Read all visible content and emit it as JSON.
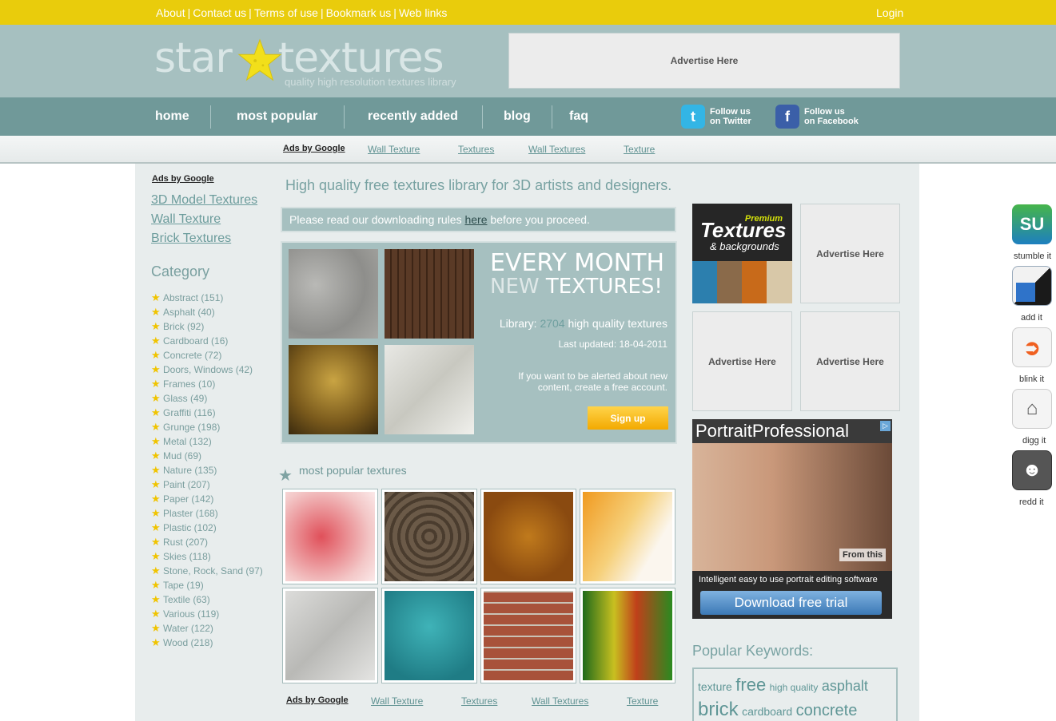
{
  "topbar": {
    "links": [
      "About",
      "Contact us",
      "Terms of use",
      "Bookmark us",
      "Web links"
    ],
    "separator": "|",
    "login": "Login"
  },
  "header": {
    "logo_left": "star",
    "logo_right": "textures",
    "tagline": "quality high resolution textures library",
    "ad": "Advertise Here"
  },
  "nav": {
    "items": [
      "home",
      "most popular",
      "recently added",
      "blog",
      "faq"
    ],
    "twitter": [
      "Follow us",
      "on Twitter"
    ],
    "facebook": [
      "Follow us",
      "on Facebook"
    ]
  },
  "adbar": {
    "ads_by": "Ads by Google",
    "links": [
      "Wall Texture",
      "Textures",
      "Wall Textures",
      "Texture"
    ]
  },
  "sidebar": {
    "ads_by": "Ads by Google",
    "links": [
      "3D Model Textures",
      "Wall Texture",
      "Brick Textures"
    ],
    "category_title": "Category",
    "categories": [
      "Abstract (151)",
      "Asphalt (40)",
      "Brick (92)",
      "Cardboard (16)",
      "Concrete (72)",
      "Doors, Windows (42)",
      "Frames (10)",
      "Glass (49)",
      "Graffiti (116)",
      "Grunge (198)",
      "Metal (132)",
      "Mud (69)",
      "Nature (135)",
      "Paint (207)",
      "Paper (142)",
      "Plaster (168)",
      "Plastic (102)",
      "Rust (207)",
      "Skies (118)",
      "Stone, Rock, Sand (97)",
      "Tape (19)",
      "Textile (63)",
      "Various (119)",
      "Water (122)",
      "Wood (218)"
    ]
  },
  "main": {
    "tagline": "High quality free textures library for 3D artists and designers.",
    "rules_before": "Please read our downloading rules ",
    "rules_link": "here",
    "rules_after": " before you proceed.",
    "promo": {
      "line1": "EVERY MONTH",
      "line2a": "NEW",
      "line2b": " TEXTURES!",
      "library_label": "Library: ",
      "library_count": "2704",
      "library_suffix": " high quality textures",
      "updated": "Last updated: 18-04-2011",
      "alert": "If you want to be alerted about new content, create a free account.",
      "signup": "Sign up"
    },
    "popular_title": "most popular textures",
    "bottom_ads_by": "Ads by Google",
    "bottom_links": [
      "Wall Texture",
      "Textures",
      "Wall Textures",
      "Texture"
    ]
  },
  "right": {
    "premium": {
      "premium": "Premium",
      "textures": "Textures",
      "backgrounds": "& backgrounds"
    },
    "ad_label": "Advertise Here",
    "portrait": {
      "title": "PortraitProfessional",
      "from_this": "From this",
      "subtitle": "Intelligent easy to use portrait editing software",
      "button": "Download free trial"
    },
    "keywords_title": "Popular Keywords:",
    "keywords": [
      "texture",
      "free",
      "high quality",
      "asphalt",
      "brick",
      "cardboard",
      "concrete"
    ]
  },
  "socialbar": {
    "labels": [
      "stumble it",
      "add it",
      "blink it",
      "digg it",
      "redd it"
    ]
  },
  "colors": {
    "topbar": "#e9cc0c",
    "header": "#a6c0c0",
    "nav": "#709999",
    "accent_link": "#6c9c9c",
    "star": "#f0c400"
  }
}
